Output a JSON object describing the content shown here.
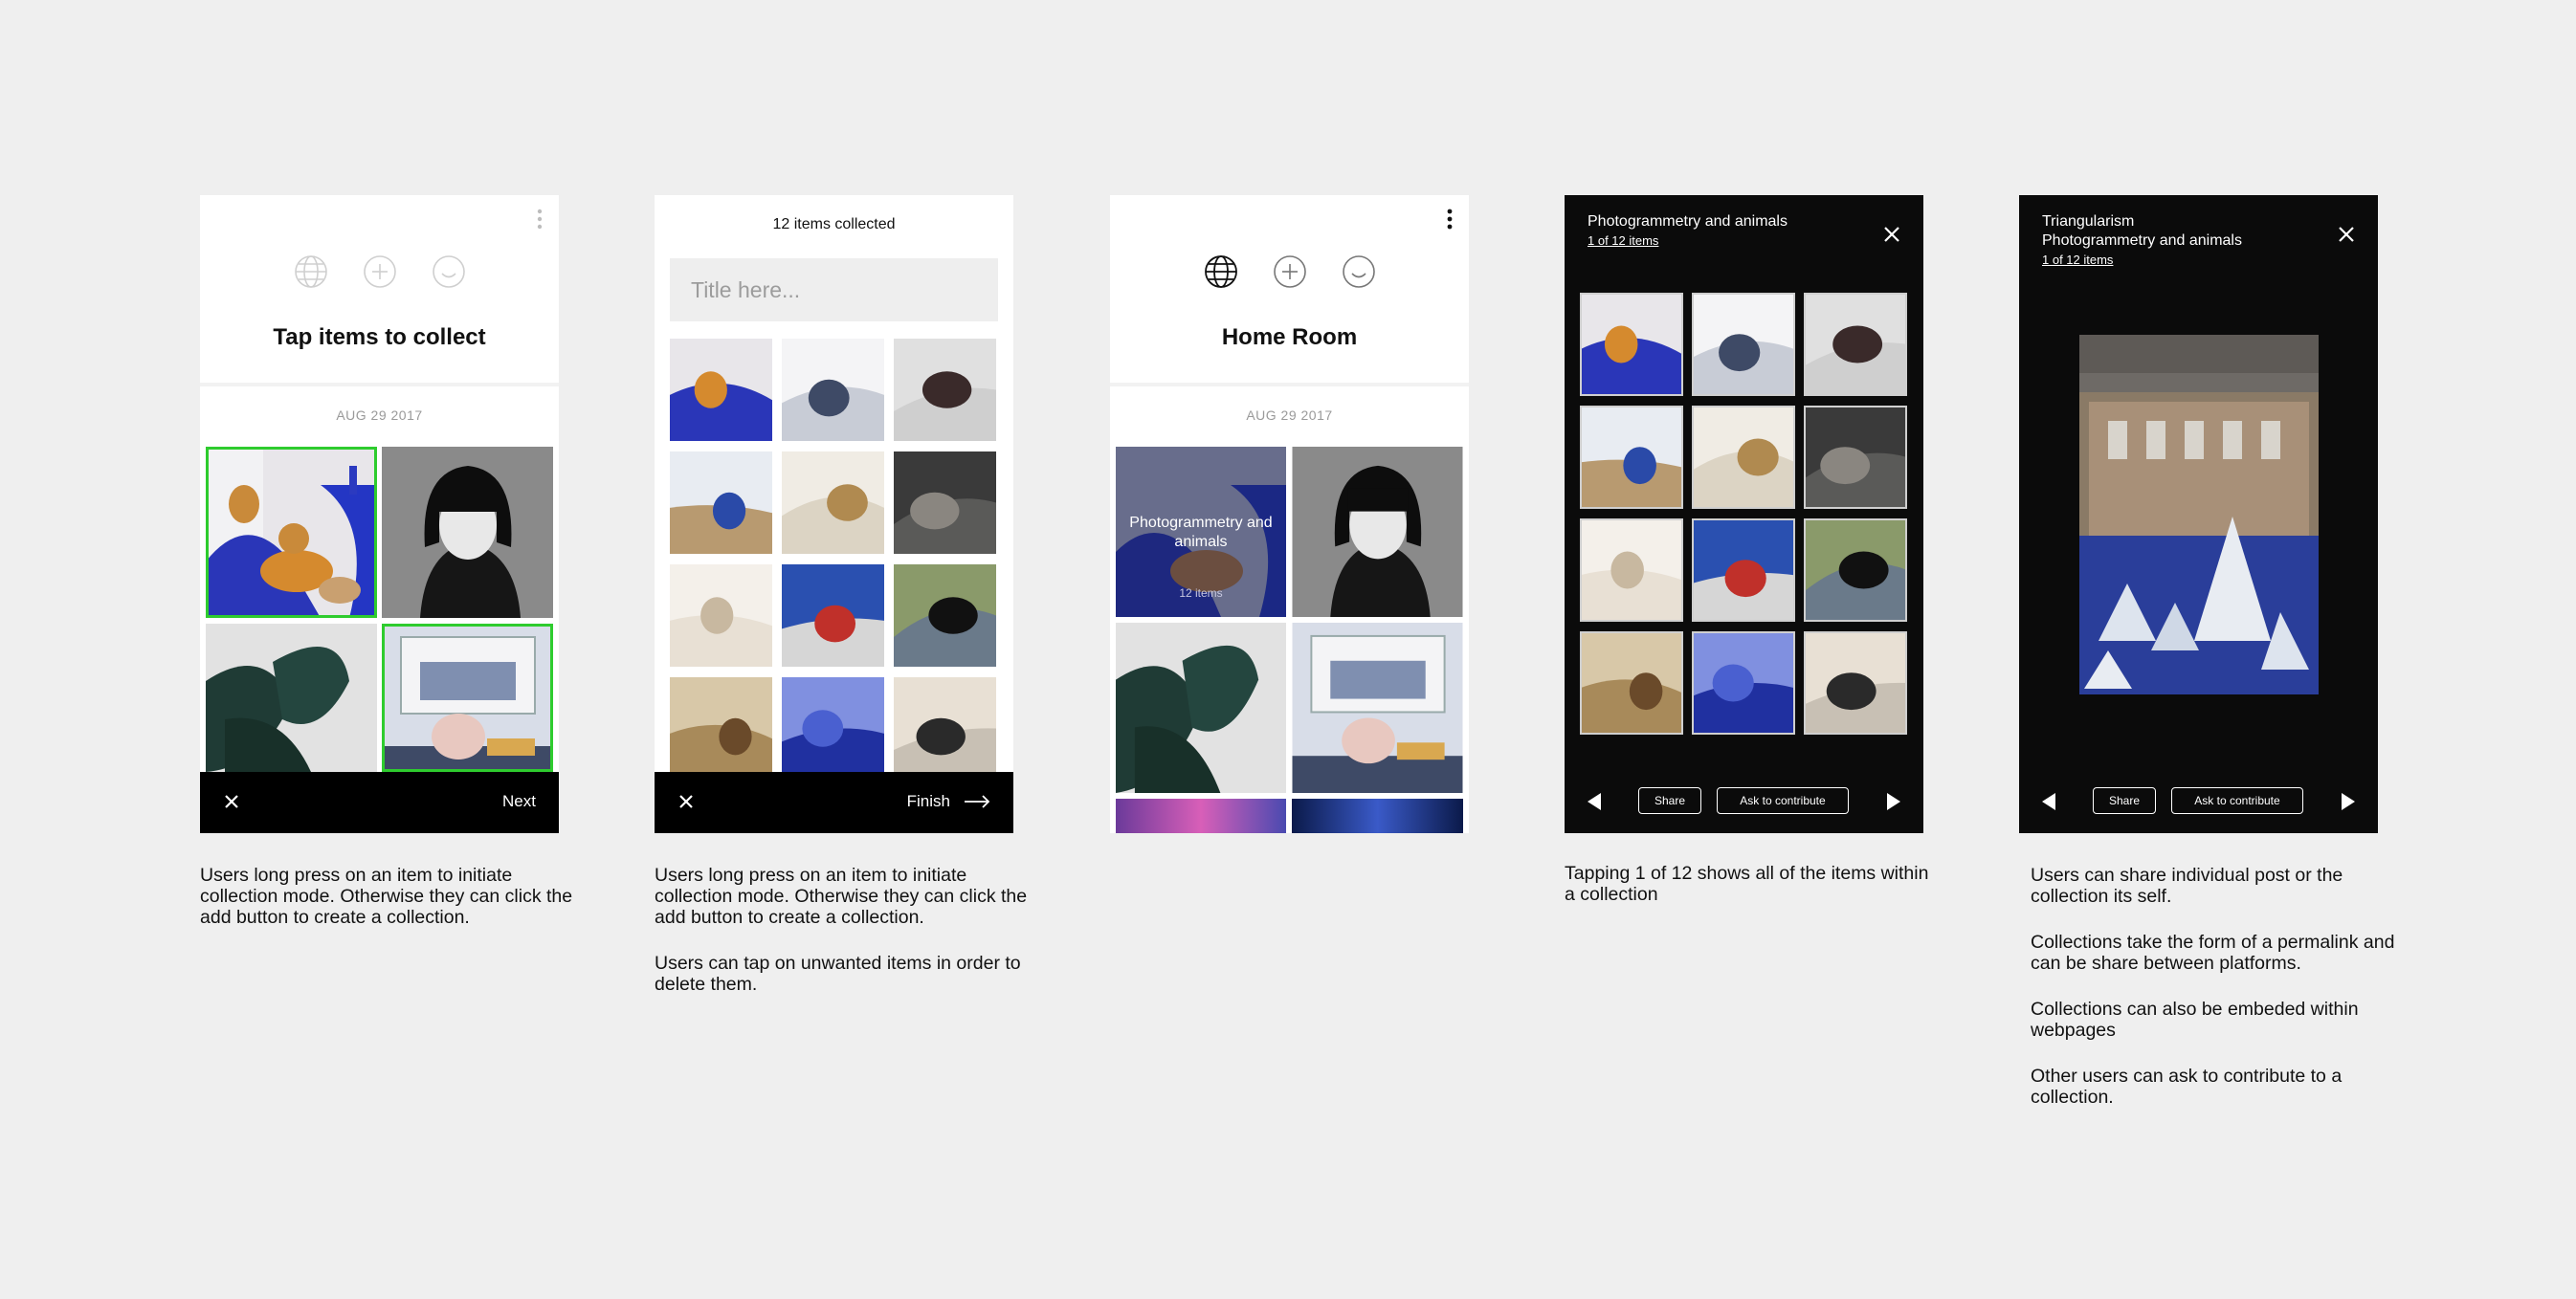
{
  "colors": {
    "selected": "#2ecc2e",
    "background": "#efefef",
    "dark_screen": "#0b0b0b"
  },
  "screen1": {
    "icons": [
      "globe-icon",
      "plus-circle-icon",
      "smile-icon"
    ],
    "title": "Tap items to collect",
    "date": "AUG 29 2017",
    "tiles": [
      {
        "subject": "cats-on-blue",
        "selected": true
      },
      {
        "subject": "portrait-bob",
        "selected": false
      },
      {
        "subject": "plant-leaves",
        "selected": false
      },
      {
        "subject": "gallery-bust",
        "selected": true
      }
    ],
    "next_label": "Next"
  },
  "screen2": {
    "count_label": "12 items collected",
    "title_placeholder": "Title here...",
    "finish_label": "Finish"
  },
  "screen3": {
    "icons": [
      "globe-icon",
      "plus-circle-icon",
      "smile-icon"
    ],
    "title": "Home Room",
    "date": "AUG 29 2017",
    "collection_title": "Photogrammetry and animals",
    "collection_count": "12 items"
  },
  "screen4": {
    "title": "Photogrammetry and animals",
    "counter_link": "1 of 12 items",
    "share_label": "Share",
    "contribute_label": "Ask to contribute"
  },
  "screen5": {
    "post_title": "Triangularism",
    "collection_title": "Photogrammetry and animals",
    "counter_link": "1 of 12 items",
    "share_label": "Share",
    "contribute_label": "Ask to contribute"
  },
  "notes": {
    "n1": [
      "Users long press on an item to initiate collection mode. Otherwise they can click the add button to create a collection."
    ],
    "n2": [
      "Users long press on an item to initiate collection mode. Otherwise they can click the add button to create a collection.",
      "Users can tap on unwanted items in order to delete them."
    ],
    "n3": [
      "Tapping 1 of 12 shows all of the items within a collection"
    ],
    "n4": [
      "Users can share individual post or the collection its self.",
      "Collections take the form of a permalink and can be share between platforms.",
      "Collections can also be embeded within webpages",
      "Other users can ask to contribute to a collection."
    ]
  }
}
